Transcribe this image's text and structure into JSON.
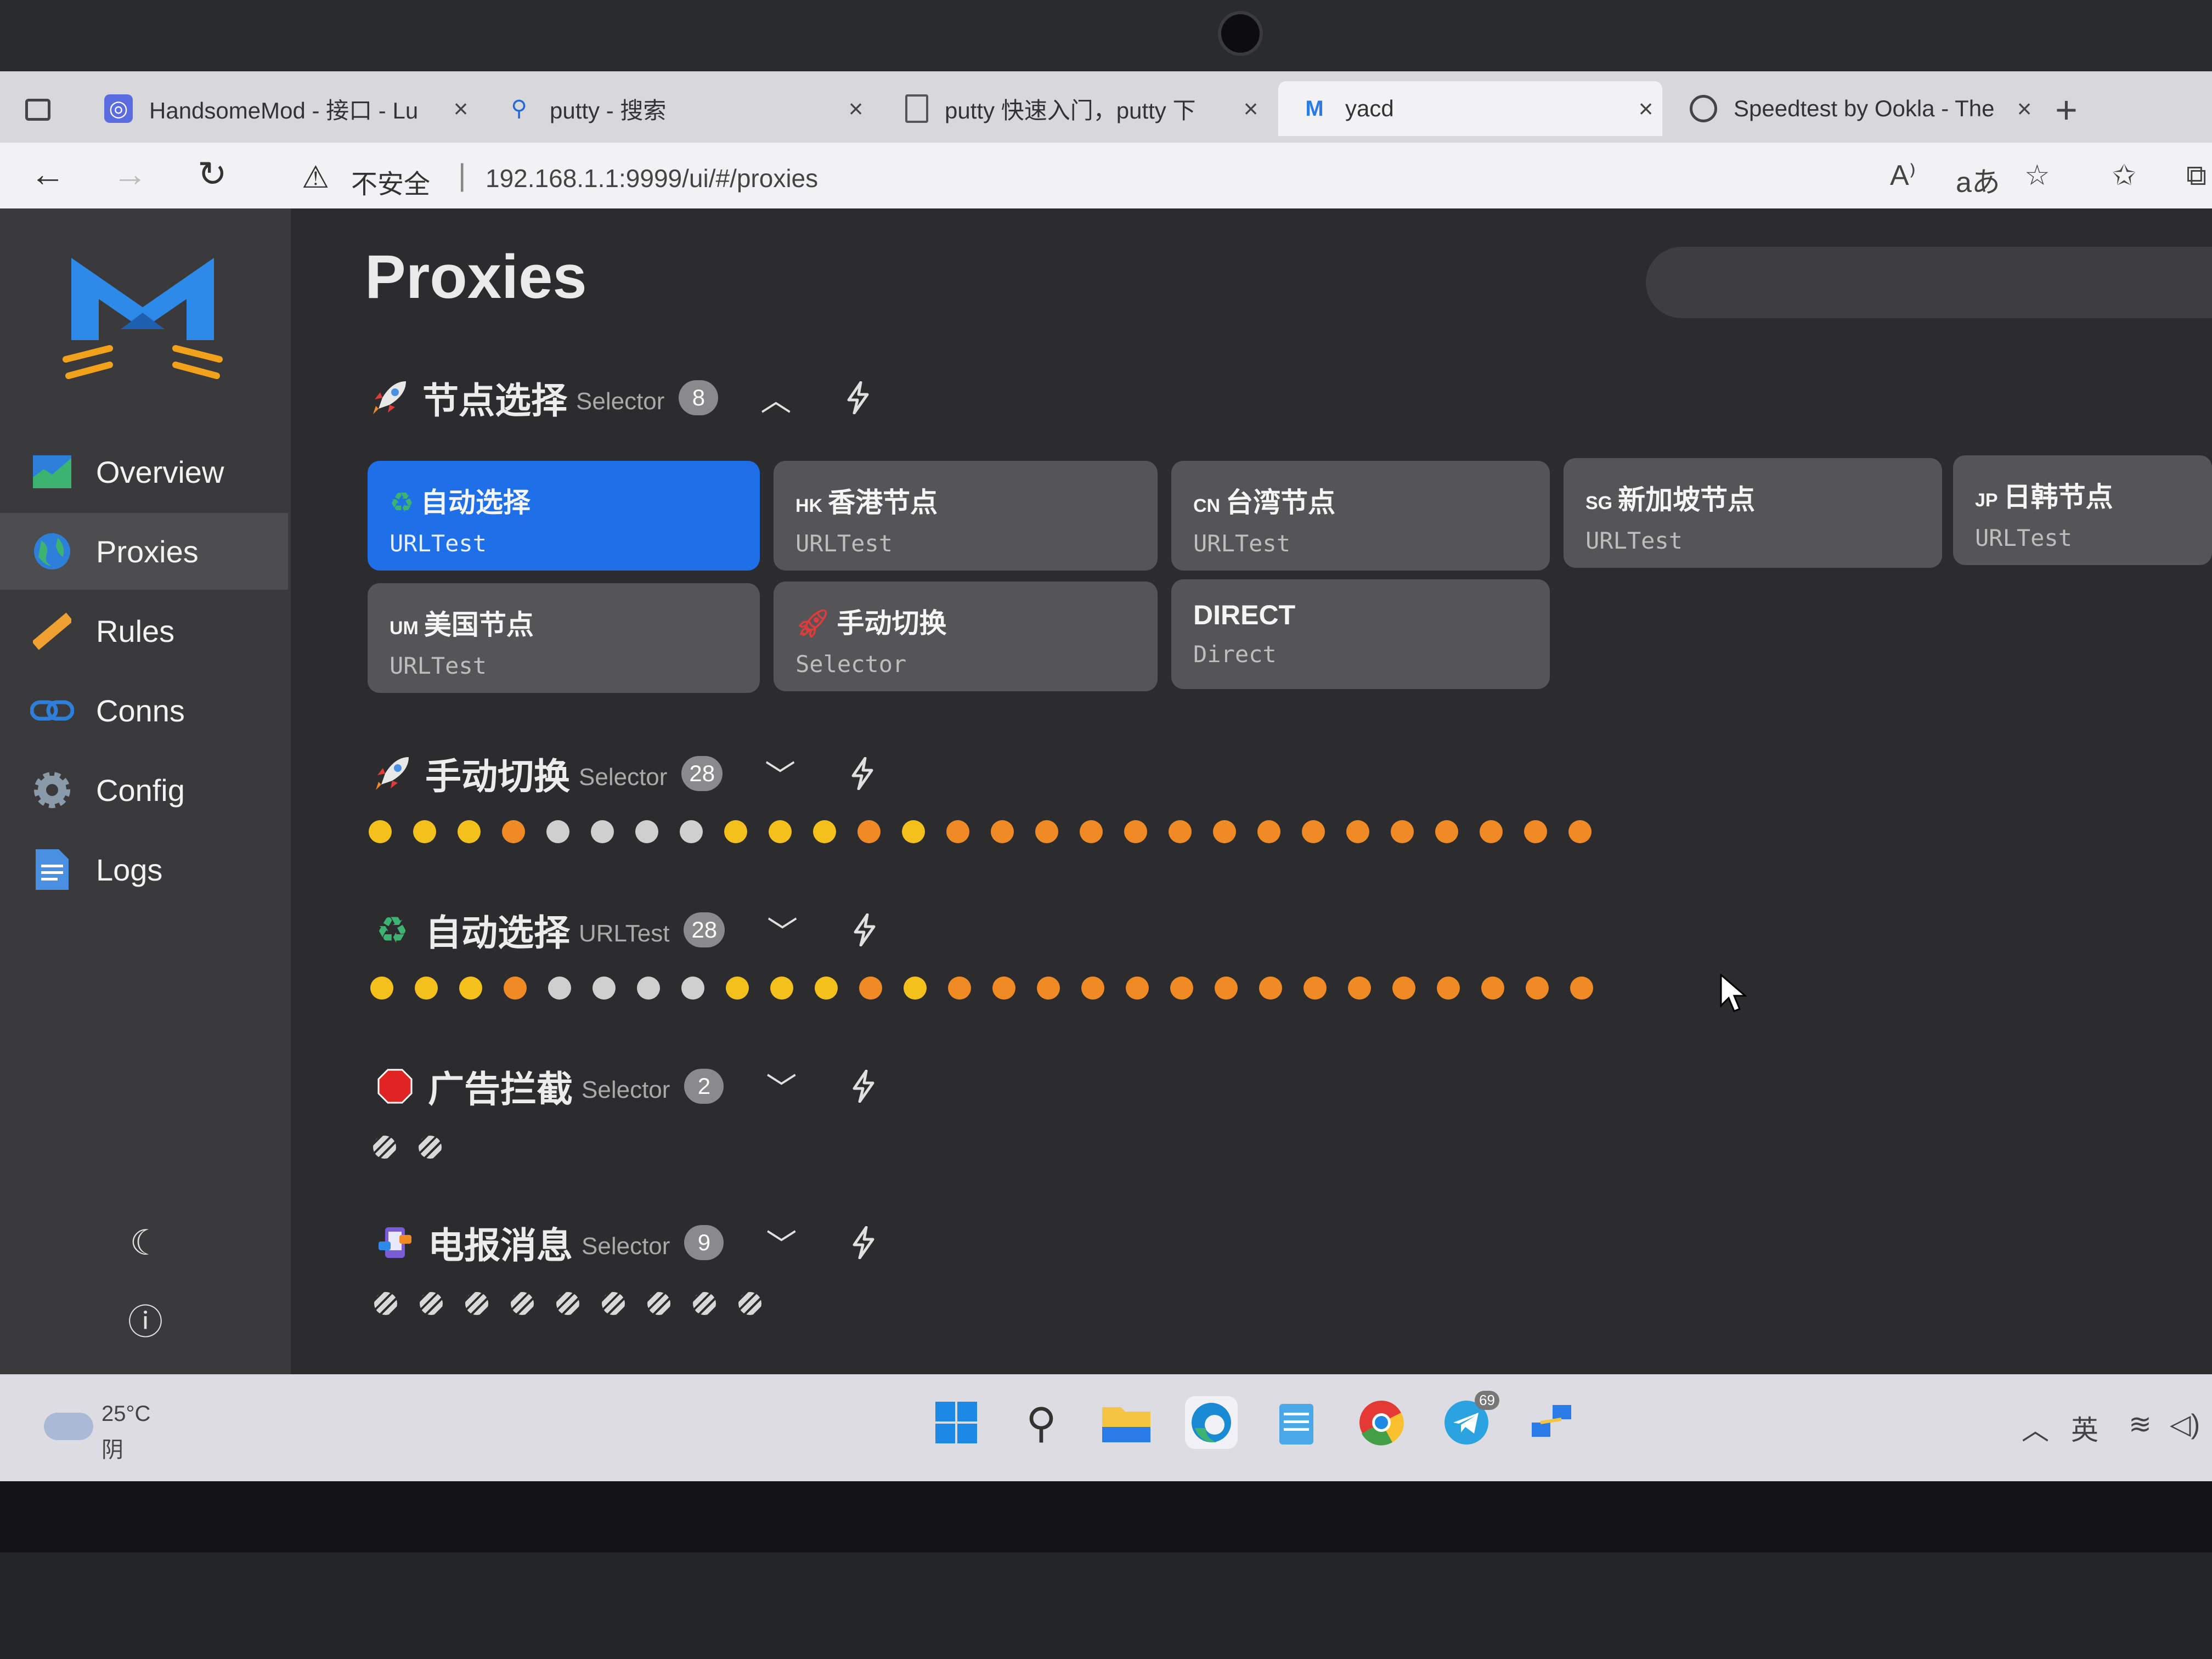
{
  "browser": {
    "tabs": [
      {
        "label": "HandsomeMod - 接口 - Lu",
        "icon": "handsomemod-icon"
      },
      {
        "label": "putty - 搜索",
        "icon": "bing-search-icon"
      },
      {
        "label": "putty 快速入门，putty 下",
        "icon": "document-icon"
      },
      {
        "label": "yacd",
        "icon": "yacd-logo-icon"
      },
      {
        "label": "Speedtest by Ookla - The",
        "icon": "speedtest-icon"
      }
    ],
    "active_tab": 3,
    "insecure_label": "不安全",
    "url": "192.168.1.1:9999/ui/#/proxies"
  },
  "sidebar": {
    "items": [
      {
        "label": "Overview",
        "icon": "chart-icon"
      },
      {
        "label": "Proxies",
        "icon": "globe-icon"
      },
      {
        "label": "Rules",
        "icon": "ruler-icon"
      },
      {
        "label": "Conns",
        "icon": "link-icon"
      },
      {
        "label": "Config",
        "icon": "gear-icon"
      },
      {
        "label": "Logs",
        "icon": "document-icon"
      }
    ],
    "active_index": 1,
    "bottom": [
      "moon-icon",
      "info-icon"
    ]
  },
  "main": {
    "title": "Proxies",
    "groups": [
      {
        "name": "节点选择",
        "type": "Selector",
        "count": "8",
        "expanded": true,
        "icon": "rocket-icon",
        "proxies": [
          {
            "flag": "",
            "name": "自动选择",
            "type": "URLTest",
            "selected": true,
            "icon": "recycle-icon"
          },
          {
            "flag": "HK",
            "name": "香港节点",
            "type": "URLTest"
          },
          {
            "flag": "CN",
            "name": "台湾节点",
            "type": "URLTest"
          },
          {
            "flag": "SG",
            "name": "新加坡节点",
            "type": "URLTest"
          },
          {
            "flag": "JP",
            "name": "日韩节点",
            "type": "URLTest"
          },
          {
            "flag": "UM",
            "name": "美国节点",
            "type": "URLTest"
          },
          {
            "flag": "",
            "name": "手动切换",
            "type": "Selector",
            "icon": "rocket-icon"
          },
          {
            "flag": "",
            "name": "DIRECT",
            "type": "Direct"
          }
        ]
      },
      {
        "name": "手动切换",
        "type": "Selector",
        "count": "28",
        "expanded": false,
        "icon": "rocket-icon",
        "dots": [
          "yellow",
          "yellow",
          "yellow",
          "orange",
          "gray",
          "gray",
          "gray",
          "gray",
          "yellow",
          "yellow",
          "yellow",
          "orange",
          "yellow",
          "orange",
          "orange",
          "orange",
          "orange",
          "orange",
          "orange",
          "orange",
          "orange",
          "orange",
          "orange",
          "orange",
          "orange",
          "orange",
          "orange",
          "orange"
        ]
      },
      {
        "name": "自动选择",
        "type": "URLTest",
        "count": "28",
        "expanded": false,
        "icon": "recycle-icon",
        "dots": [
          "yellow",
          "yellow",
          "yellow",
          "orange",
          "gray",
          "gray",
          "gray",
          "gray",
          "yellow",
          "yellow",
          "yellow",
          "orange",
          "yellow",
          "orange",
          "orange",
          "orange",
          "orange",
          "orange",
          "orange",
          "orange",
          "orange",
          "orange",
          "orange",
          "orange",
          "orange",
          "orange",
          "orange",
          "orange"
        ]
      },
      {
        "name": "广告拦截",
        "type": "Selector",
        "count": "2",
        "expanded": false,
        "icon": "stop-sign-icon",
        "dots": [
          "na",
          "na"
        ]
      },
      {
        "name": "电报消息",
        "type": "Selector",
        "count": "9",
        "expanded": false,
        "icon": "telegram-message-icon",
        "dots": [
          "na",
          "na",
          "na",
          "na",
          "na",
          "na",
          "na",
          "na",
          "na"
        ]
      }
    ]
  },
  "taskbar": {
    "weather_temp": "25°C",
    "weather_cond": "阴",
    "apps": [
      "windows-start-icon",
      "search-icon",
      "file-explorer-icon",
      "edge-icon",
      "notepad-icon",
      "chrome-icon",
      "telegram-icon",
      "network-icon"
    ],
    "telegram_badge": "69",
    "ime": "英"
  },
  "colors": {
    "selected_card": "#1e6fe8",
    "latency_orange": "#f08a24",
    "latency_yellow": "#f4c01c",
    "latency_gray": "#cfcfcf"
  }
}
